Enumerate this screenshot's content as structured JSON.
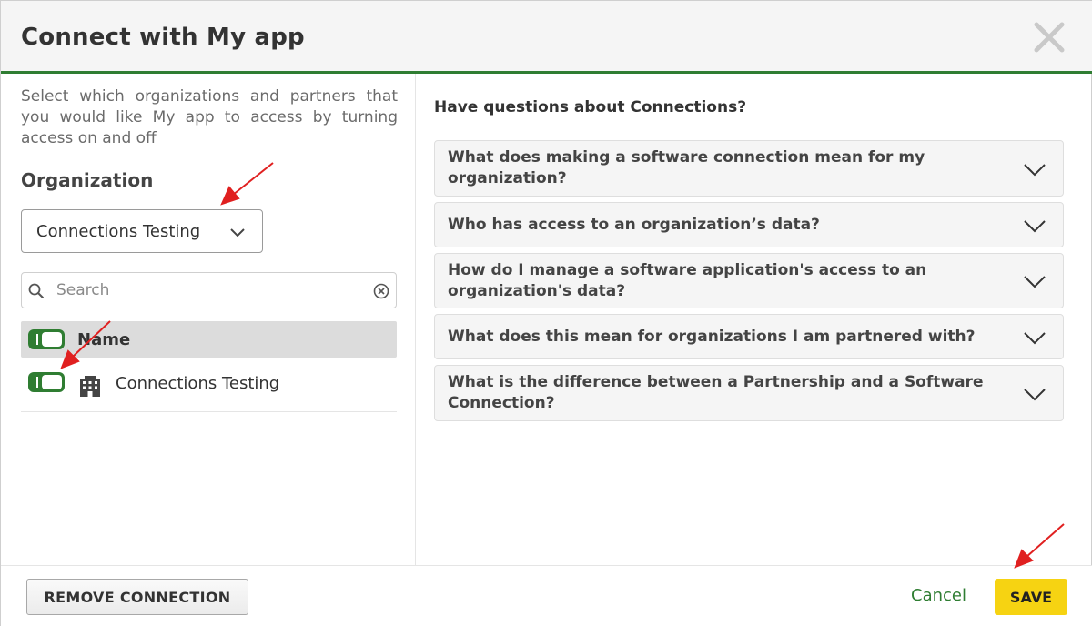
{
  "dialog": {
    "title": "Connect with My app",
    "close_icon": "close-icon"
  },
  "left_panel": {
    "intro": "Select which organizations and partners that you would like My app to access by turning access on and off",
    "org_label": "Organization",
    "org_select_value": "Connections Testing",
    "search_placeholder": "Search",
    "search_value": "",
    "table_header": "Name",
    "rows": [
      {
        "label": "Connections Testing",
        "access_on": true,
        "icon": "building-icon"
      }
    ]
  },
  "right_panel": {
    "title": "Have questions about Connections?",
    "faqs": [
      {
        "question": "What does making a software connection mean for my organization?"
      },
      {
        "question": "Who has access to an organization’s data?"
      },
      {
        "question": "How do I manage a software application's access to an organization's data?"
      },
      {
        "question": "What does this mean for organizations I am partnered with?"
      },
      {
        "question": "What is the difference between a Partnership and a Software Connection?"
      }
    ]
  },
  "footer": {
    "remove_label": "REMOVE CONNECTION",
    "cancel_label": "Cancel",
    "save_label": "SAVE"
  },
  "colors": {
    "accent_green": "#2f7d32",
    "save_yellow": "#f6d312",
    "annotation_red": "#e02020"
  }
}
